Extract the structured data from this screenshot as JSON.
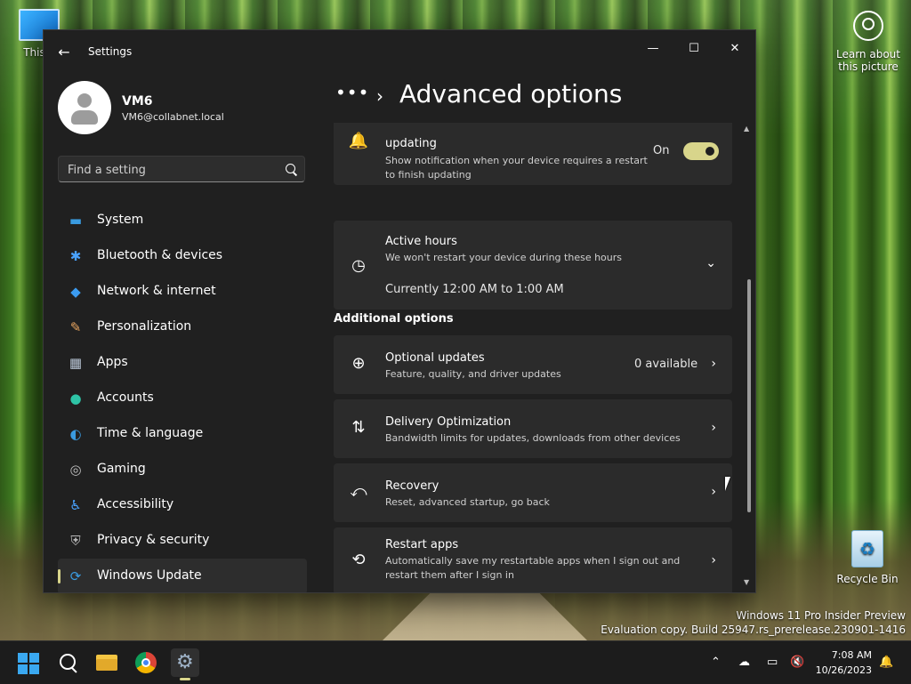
{
  "desktop": {
    "this_pc_label": "This P",
    "learn_label": "Learn about this picture",
    "recycle_label": "Recycle Bin",
    "watermark_line1": "Windows 11 Pro Insider Preview",
    "watermark_line2": "Evaluation copy. Build 25947.rs_prerelease.230901-1416"
  },
  "window": {
    "title": "Settings",
    "controls": {
      "minimize": "—",
      "maximize": "☐",
      "close": "✕"
    }
  },
  "user": {
    "name": "VM6",
    "email": "VM6@collabnet.local"
  },
  "search": {
    "placeholder": "Find a setting"
  },
  "nav": {
    "items": [
      {
        "label": "System",
        "icon": "monitor-icon",
        "color": "#3a9be0"
      },
      {
        "label": "Bluetooth & devices",
        "icon": "bluetooth-icon",
        "color": "#4aa3ff"
      },
      {
        "label": "Network & internet",
        "icon": "wifi-icon",
        "color": "#3b9bf0"
      },
      {
        "label": "Personalization",
        "icon": "brush-icon",
        "color": "#e8a560"
      },
      {
        "label": "Apps",
        "icon": "apps-icon",
        "color": "#b9c6d6"
      },
      {
        "label": "Accounts",
        "icon": "person-icon",
        "color": "#2ec4a6"
      },
      {
        "label": "Time & language",
        "icon": "globe-clock-icon",
        "color": "#3a9be0"
      },
      {
        "label": "Gaming",
        "icon": "gamepad-icon",
        "color": "#bfbfbf"
      },
      {
        "label": "Accessibility",
        "icon": "accessibility-icon",
        "color": "#4aa3ff"
      },
      {
        "label": "Privacy & security",
        "icon": "shield-icon",
        "color": "#b8b8b8"
      },
      {
        "label": "Windows Update",
        "icon": "update-icon",
        "color": "#3a9be0",
        "active": true
      }
    ]
  },
  "breadcrumb": {
    "dots": "•••",
    "separator": "›",
    "title": "Advanced options"
  },
  "content": {
    "notify": {
      "title": "updating",
      "desc": "Show notification when your device requires a restart to finish updating",
      "toggle_label": "On",
      "toggle_on": true
    },
    "active_hours": {
      "title": "Active hours",
      "desc": "We won't restart your device during these hours",
      "current": "Currently 12:00 AM to 1:00 AM"
    },
    "section_title": "Additional options",
    "options": [
      {
        "title": "Optional updates",
        "desc": "Feature, quality, and driver updates",
        "value": "0 available",
        "icon": "plus-circle-icon"
      },
      {
        "title": "Delivery Optimization",
        "desc": "Bandwidth limits for updates, downloads from other devices",
        "value": "",
        "icon": "delivery-icon"
      },
      {
        "title": "Recovery",
        "desc": "Reset, advanced startup, go back",
        "value": "",
        "icon": "recovery-icon"
      },
      {
        "title": "Restart apps",
        "desc": "Automatically save my restartable apps when I sign out and restart them after I sign in",
        "value": "",
        "icon": "restart-apps-icon"
      }
    ]
  },
  "taskbar": {
    "time": "7:08 AM",
    "date": "10/26/2023"
  },
  "colors": {
    "accent": "#d8d58b",
    "window_bg": "#202020",
    "card_bg": "#2b2b2b"
  }
}
